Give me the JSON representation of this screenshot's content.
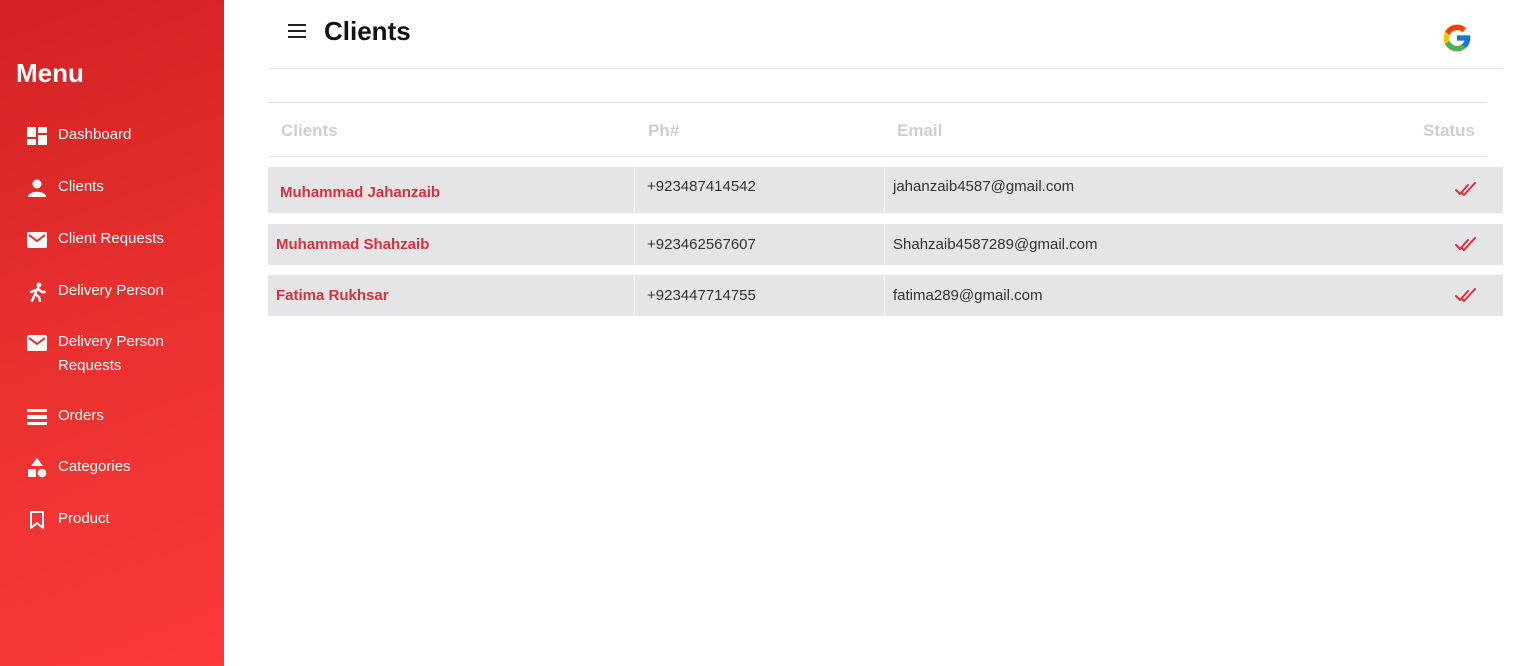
{
  "sidebar": {
    "title": "Menu",
    "items": [
      {
        "label": "Dashboard",
        "icon": "dashboard-icon"
      },
      {
        "label": "Clients",
        "icon": "person-icon"
      },
      {
        "label": "Client Requests",
        "icon": "mail-icon"
      },
      {
        "label": "Delivery Person",
        "icon": "running-person-icon"
      },
      {
        "label": "Delivery Person Requests",
        "icon": "mail-icon"
      },
      {
        "label": "Orders",
        "icon": "list-icon"
      },
      {
        "label": "Categories",
        "icon": "shapes-icon"
      },
      {
        "label": "Product",
        "icon": "bookmark-icon"
      }
    ],
    "color": "#e3292b"
  },
  "header": {
    "title": "Clients",
    "menu_icon": "hamburger-icon",
    "account_icon": "google-icon"
  },
  "table": {
    "columns": [
      "Clients",
      "Ph#",
      "Email",
      "Status"
    ],
    "rows": [
      {
        "name": "Muhammad Jahanzaib",
        "phone": "+923487414542",
        "email": "jahanzaib4587@gmail.com",
        "status_icon": "double-check-icon"
      },
      {
        "name": "Muhammad Shahzaib",
        "phone": "+923462567607",
        "email": "Shahzaib4587289@gmail.com",
        "status_icon": "double-check-icon"
      },
      {
        "name": "Fatima Rukhsar",
        "phone": "+923447714755",
        "email": "fatima289@gmail.com",
        "status_icon": "double-check-icon"
      }
    ]
  },
  "colors": {
    "accent": "#d8313a",
    "row_bg": "#e5e5e7",
    "header_text": "#cfcfcf"
  }
}
